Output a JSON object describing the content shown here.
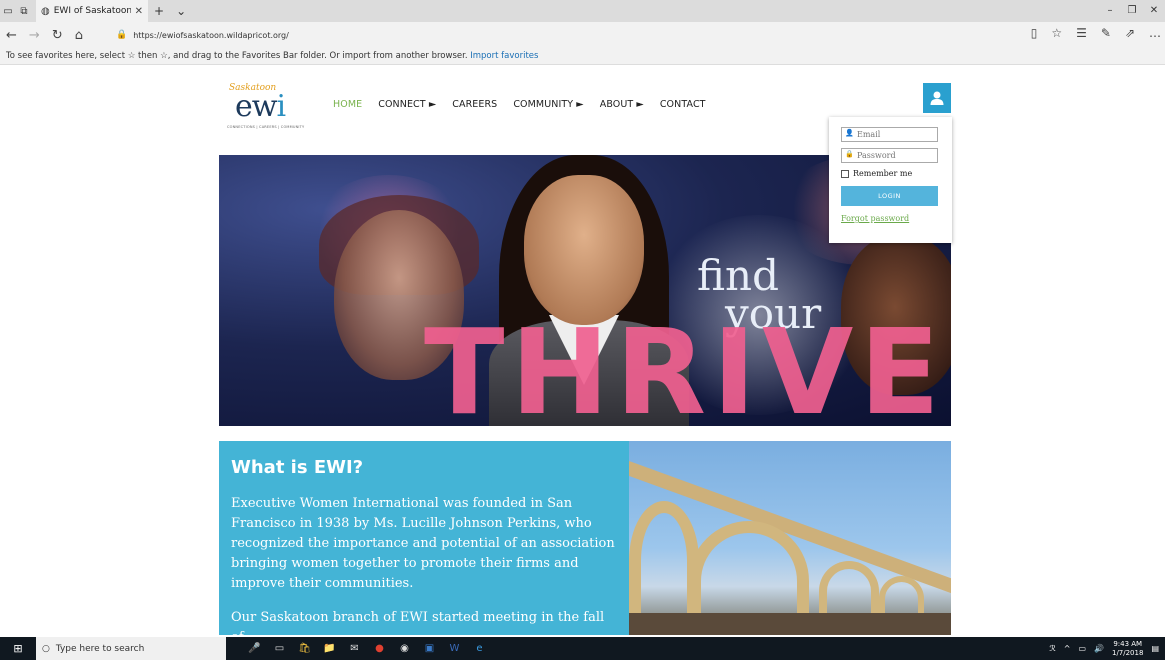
{
  "browser": {
    "tab_title": "EWI of Saskatoon - Hon",
    "url": "https://ewiofsaskatoon.wildapricot.org/",
    "favbar_text": "To see favorites here, select ☆ then ☆, and drag to the Favorites Bar folder. Or import from another browser.",
    "favbar_link": "Import favorites"
  },
  "logo": {
    "script": "Saskatoon",
    "mark_e": "ew",
    "mark_i": "i",
    "tagline": "CONNECTIONS | CAREERS | COMMUNITY"
  },
  "menu": {
    "home": "HOME",
    "connect": "CONNECT ►",
    "careers": "CAREERS",
    "community": "COMMUNITY ►",
    "about": "ABOUT ►",
    "contact": "CONTACT"
  },
  "login": {
    "email_placeholder": "Email",
    "password_placeholder": "Password",
    "remember": "Remember me",
    "button": "LOGIN",
    "forgot": "Forgot password"
  },
  "hero": {
    "find": "find",
    "your": "your",
    "thrive": "THRIVE"
  },
  "what": {
    "title": "What is EWI?",
    "p1": "Executive Women International was founded in San Francisco in 1938 by Ms. Lucille Johnson Perkins, who recognized the importance and potential of an association bringing women together to promote their firms and improve their communities.",
    "p2": "Our Saskatoon branch of EWI started meeting in the fall of"
  },
  "taskbar": {
    "search_placeholder": "Type here to search",
    "time": "9:43 AM",
    "date": "1/7/2018"
  }
}
